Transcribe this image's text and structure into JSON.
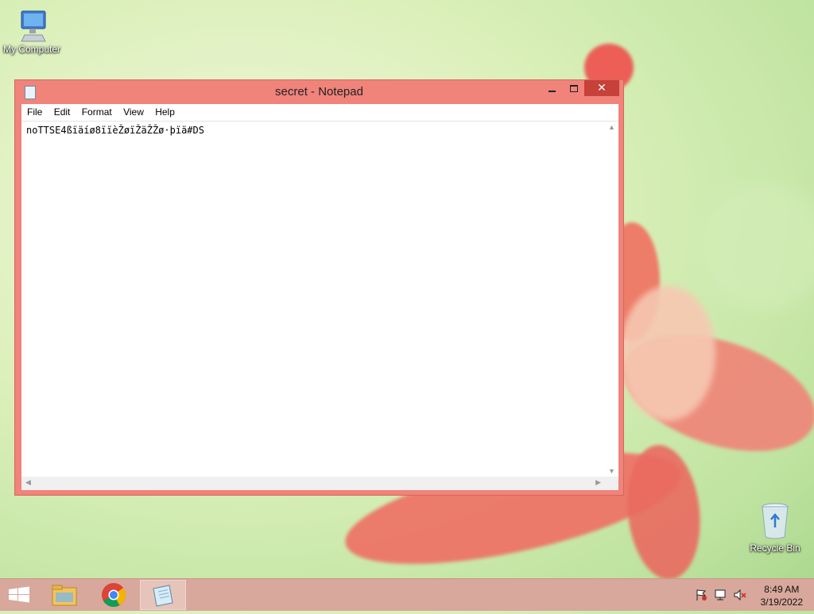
{
  "desktop": {
    "icons": [
      {
        "label": "My Computer"
      },
      {
        "label": "Recycle Bin"
      }
    ]
  },
  "window": {
    "title": "secret - Notepad",
    "close_glyph": "✕",
    "menu": [
      "File",
      "Edit",
      "Format",
      "View",
      "Help"
    ],
    "content": "noTTSE4ßïäíø8ïïèŽøïŽäŽŽø·þïä#DS"
  },
  "taskbar": {
    "apps": [
      {
        "name": "start-button"
      },
      {
        "name": "file-explorer"
      },
      {
        "name": "chrome"
      },
      {
        "name": "notepad",
        "active": true
      }
    ],
    "time": "8:49 AM",
    "date": "3/19/2022"
  },
  "colors": {
    "window_frame": "#f0837a",
    "close_button": "#c7403a",
    "taskbar": "#d7a89b"
  }
}
